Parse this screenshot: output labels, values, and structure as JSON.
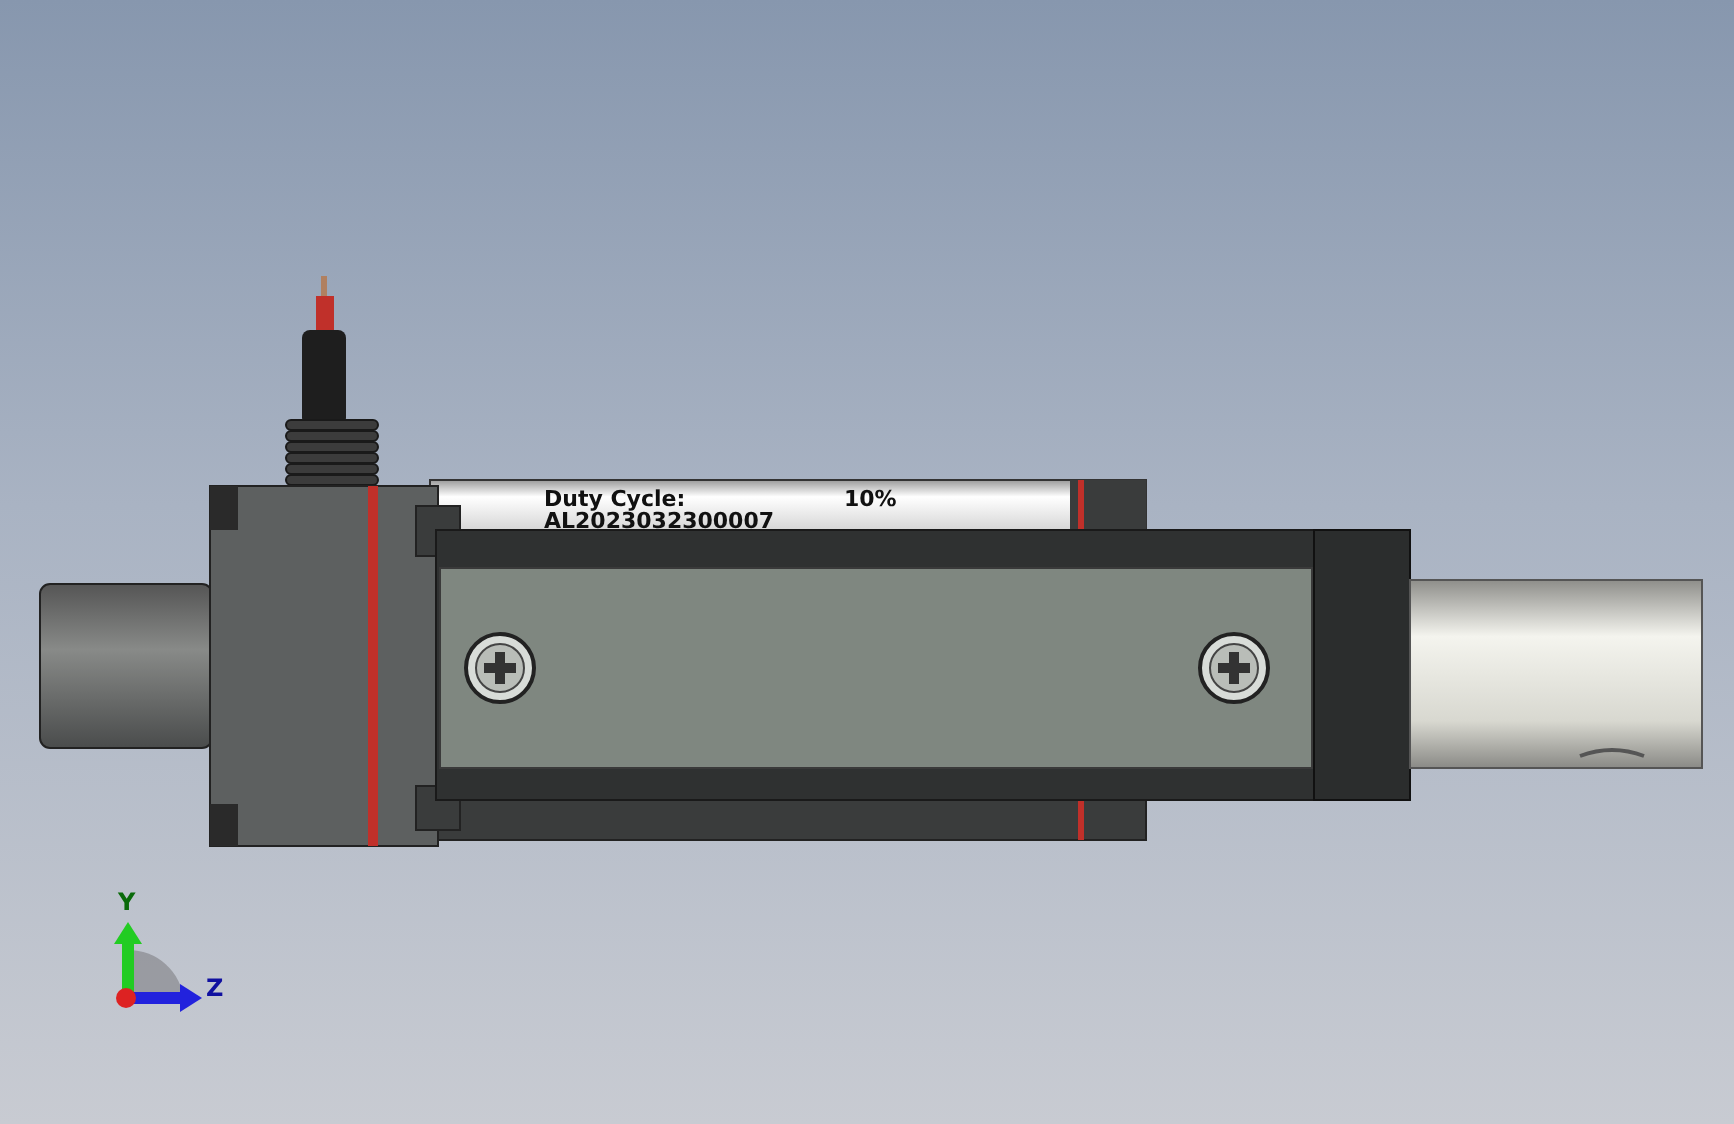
{
  "label": {
    "lines": [
      "Duty Cycle:",
      "AL2023032300007"
    ],
    "duty": "10%"
  },
  "triad": {
    "axes": [
      "Y",
      "Z"
    ]
  }
}
